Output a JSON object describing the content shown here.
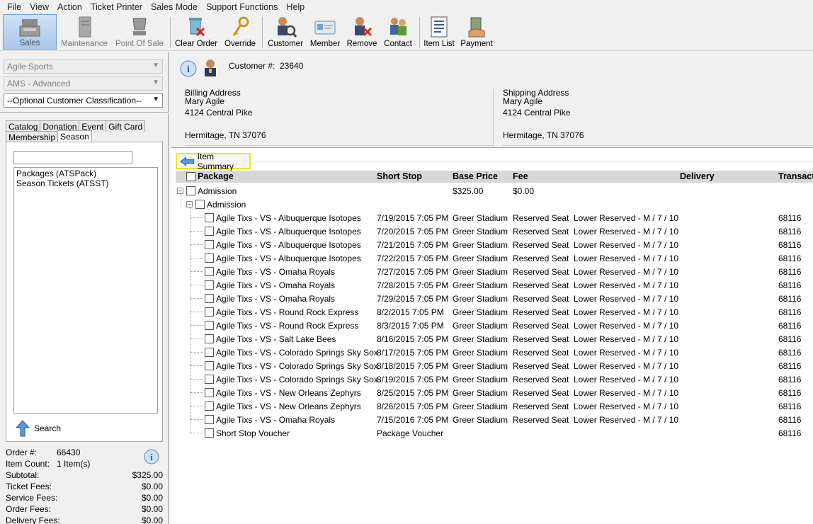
{
  "menu": [
    "File",
    "View",
    "Action",
    "Ticket Printer",
    "Sales Mode",
    "Support Functions",
    "Help"
  ],
  "toolbar": {
    "sales": "Sales",
    "maintenance": "Maintenance",
    "point_of_sale": "Point Of Sale",
    "clear_order": "Clear Order",
    "override": "Override",
    "customer": "Customer",
    "member": "Member",
    "remove": "Remove",
    "contact": "Contact",
    "item_list": "Item List",
    "payment": "Payment"
  },
  "left": {
    "org": "Agile Sports",
    "mode": "AMS - Advanced",
    "classification": "--Optional Customer Classification--",
    "tabs_row1": [
      "Catalog",
      "Donation",
      "Event",
      "Gift Card"
    ],
    "tabs_row2": [
      "Membership",
      "Season"
    ],
    "search_value": "",
    "list_items": [
      "Packages  (ATSPack)",
      "Season Tickets  (ATSST)"
    ],
    "search_label": "Search"
  },
  "totals": [
    {
      "label": "Order #:",
      "value": "66430"
    },
    {
      "label": "Item Count:",
      "value": "1 Item(s)"
    },
    {
      "label": "Subtotal:",
      "value": "$325.00"
    },
    {
      "label": "Ticket Fees:",
      "value": "$0.00"
    },
    {
      "label": "Service Fees:",
      "value": "$0.00"
    },
    {
      "label": "Order Fees:",
      "value": "$0.00"
    },
    {
      "label": "Delivery Fees:",
      "value": "$0.00"
    }
  ],
  "customer": {
    "number_label": "Customer #:",
    "number": "23640",
    "billing_title": "Billing Address",
    "billing": [
      "Mary Agile",
      "4124 Central Pike",
      "",
      "Hermitage, TN 37076"
    ],
    "shipping_title": "Shipping Address",
    "shipping": [
      "Mary Agile",
      "4124 Central Pike",
      "",
      "Hermitage, TN 37076"
    ]
  },
  "grid": {
    "item_summary": "Item Summary",
    "headers": {
      "package": "Package",
      "short_stop": "Short Stop",
      "base_price": "Base Price",
      "fee": "Fee",
      "delivery": "Delivery",
      "transact": "Transact"
    },
    "top": {
      "name": "Admission",
      "base_price": "$325.00",
      "fee": "$0.00"
    },
    "sub": {
      "name": "Admission"
    },
    "rows": [
      {
        "name": "Agile Tixs - VS - Albuquerque Isotopes",
        "date": "7/19/2015 7:05 PM",
        "venue": "Greer Stadium",
        "type": "Reserved Seat",
        "seat": "Lower Reserved - M / 7 / 10",
        "id": "68116"
      },
      {
        "name": "Agile Tixs - VS - Albuquerque Isotopes",
        "date": "7/20/2015 7:05 PM",
        "venue": "Greer Stadium",
        "type": "Reserved Seat",
        "seat": "Lower Reserved - M / 7 / 10",
        "id": "68116"
      },
      {
        "name": "Agile Tixs - VS - Albuquerque Isotopes",
        "date": "7/21/2015 7:05 PM",
        "venue": "Greer Stadium",
        "type": "Reserved Seat",
        "seat": "Lower Reserved - M / 7 / 10",
        "id": "68116"
      },
      {
        "name": "Agile Tixs - VS - Albuquerque Isotopes",
        "date": "7/22/2015 7:05 PM",
        "venue": "Greer Stadium",
        "type": "Reserved Seat",
        "seat": "Lower Reserved - M / 7 / 10",
        "id": "68116"
      },
      {
        "name": "Agile Tixs - VS - Omaha Royals",
        "date": "7/27/2015 7:05 PM",
        "venue": "Greer Stadium",
        "type": "Reserved Seat",
        "seat": "Lower Reserved - M / 7 / 10",
        "id": "68116"
      },
      {
        "name": "Agile Tixs - VS - Omaha Royals",
        "date": "7/28/2015 7:05 PM",
        "venue": "Greer Stadium",
        "type": "Reserved Seat",
        "seat": "Lower Reserved - M / 7 / 10",
        "id": "68116"
      },
      {
        "name": "Agile Tixs - VS - Omaha Royals",
        "date": "7/29/2015 7:05 PM",
        "venue": "Greer Stadium",
        "type": "Reserved Seat",
        "seat": "Lower Reserved - M / 7 / 10",
        "id": "68116"
      },
      {
        "name": "Agile Tixs - VS - Round Rock Express",
        "date": "8/2/2015 7:05 PM",
        "venue": "Greer Stadium",
        "type": "Reserved Seat",
        "seat": "Lower Reserved - M / 7 / 10",
        "id": "68116"
      },
      {
        "name": "Agile Tixs - VS - Round Rock Express",
        "date": "8/3/2015 7:05 PM",
        "venue": "Greer Stadium",
        "type": "Reserved Seat",
        "seat": "Lower Reserved - M / 7 / 10",
        "id": "68116"
      },
      {
        "name": "Agile Tixs - VS - Salt Lake Bees",
        "date": "8/16/2015 7:05 PM",
        "venue": "Greer Stadium",
        "type": "Reserved Seat",
        "seat": "Lower Reserved - M / 7 / 10",
        "id": "68116"
      },
      {
        "name": "Agile Tixs - VS - Colorado Springs Sky Sox",
        "date": "8/17/2015 7:05 PM",
        "venue": "Greer Stadium",
        "type": "Reserved Seat",
        "seat": "Lower Reserved - M / 7 / 10",
        "id": "68116"
      },
      {
        "name": "Agile Tixs - VS - Colorado Springs Sky Sox",
        "date": "8/18/2015 7:05 PM",
        "venue": "Greer Stadium",
        "type": "Reserved Seat",
        "seat": "Lower Reserved - M / 7 / 10",
        "id": "68116"
      },
      {
        "name": "Agile Tixs - VS - Colorado Springs Sky Sox",
        "date": "8/19/2015 7:05 PM",
        "venue": "Greer Stadium",
        "type": "Reserved Seat",
        "seat": "Lower Reserved - M / 7 / 10",
        "id": "68116"
      },
      {
        "name": "Agile Tixs - VS - New Orleans Zephyrs",
        "date": "8/25/2015 7:05 PM",
        "venue": "Greer Stadium",
        "type": "Reserved Seat",
        "seat": "Lower Reserved - M / 7 / 10",
        "id": "68116"
      },
      {
        "name": "Agile Tixs - VS - New Orleans Zephyrs",
        "date": "8/26/2015 7:05 PM",
        "venue": "Greer Stadium",
        "type": "Reserved Seat",
        "seat": "Lower Reserved - M / 7 / 10",
        "id": "68116"
      },
      {
        "name": "Agile Tixs  - VS - Omaha Royals",
        "date": "7/15/2016 7:05 PM",
        "venue": "Greer Stadium",
        "type": "Reserved Seat",
        "seat": "Lower Reserved - M / 7 / 10",
        "id": "68116"
      },
      {
        "name": "Short Stop Voucher",
        "date": "Package Voucher",
        "venue": "",
        "type": "",
        "seat": "",
        "id": "68116"
      }
    ]
  }
}
